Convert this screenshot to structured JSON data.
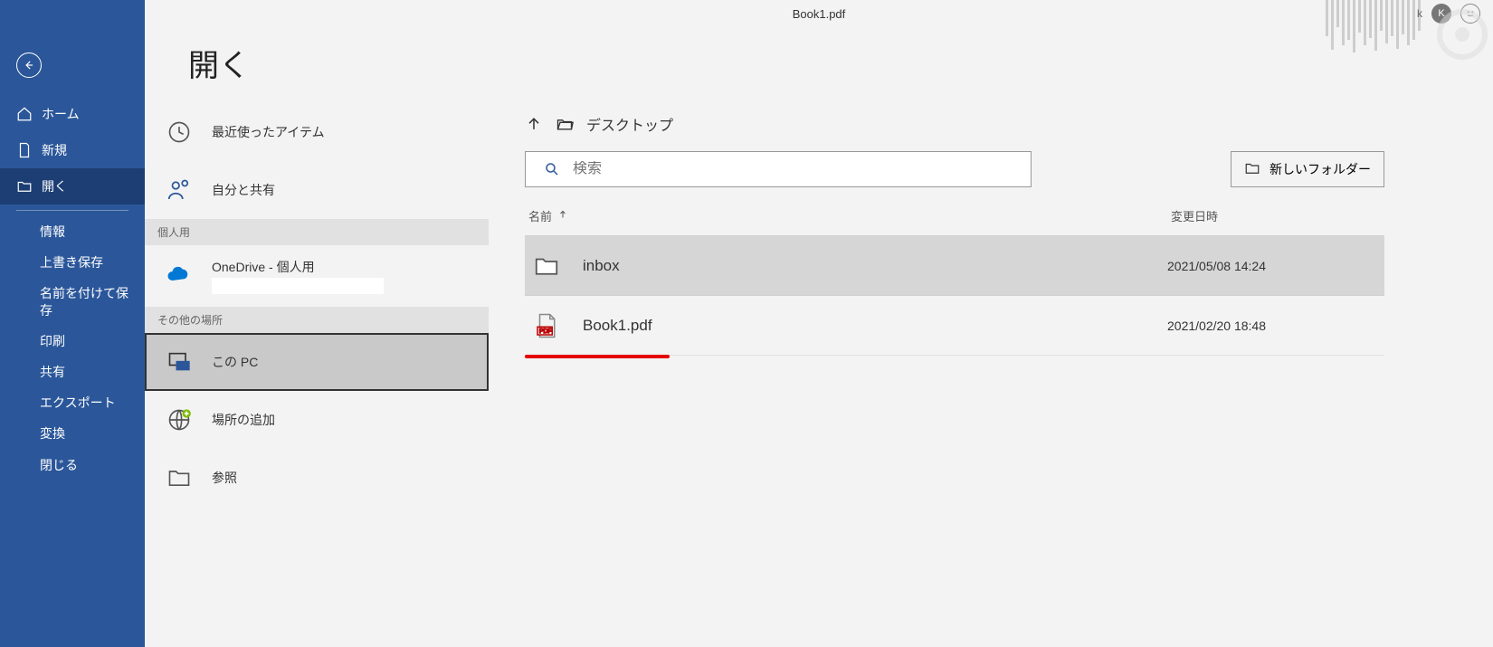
{
  "titlebar": {
    "document_title": "Book1.pdf",
    "user_initial_text": "k",
    "avatar_letter": "K"
  },
  "sidebar": {
    "home": "ホーム",
    "new": "新規",
    "open": "開く",
    "info": "情報",
    "save": "上書き保存",
    "save_as": "名前を付けて保存",
    "print": "印刷",
    "share": "共有",
    "export": "エクスポート",
    "transform": "変換",
    "close": "閉じる"
  },
  "page": {
    "title": "開く"
  },
  "locations": {
    "recent": "最近使ったアイテム",
    "shared": "自分と共有",
    "group_personal": "個人用",
    "onedrive": "OneDrive - 個人用",
    "group_other": "その他の場所",
    "this_pc": "この PC",
    "add_place": "場所の追加",
    "browse": "参照"
  },
  "main": {
    "breadcrumb": "デスクトップ",
    "search_placeholder": "検索",
    "new_folder": "新しいフォルダー",
    "col_name": "名前",
    "col_date": "変更日時",
    "rows": [
      {
        "name": "inbox",
        "date": "2021/05/08 14:24",
        "type": "folder"
      },
      {
        "name": "Book1.pdf",
        "date": "2021/02/20 18:48",
        "type": "pdf"
      }
    ]
  }
}
